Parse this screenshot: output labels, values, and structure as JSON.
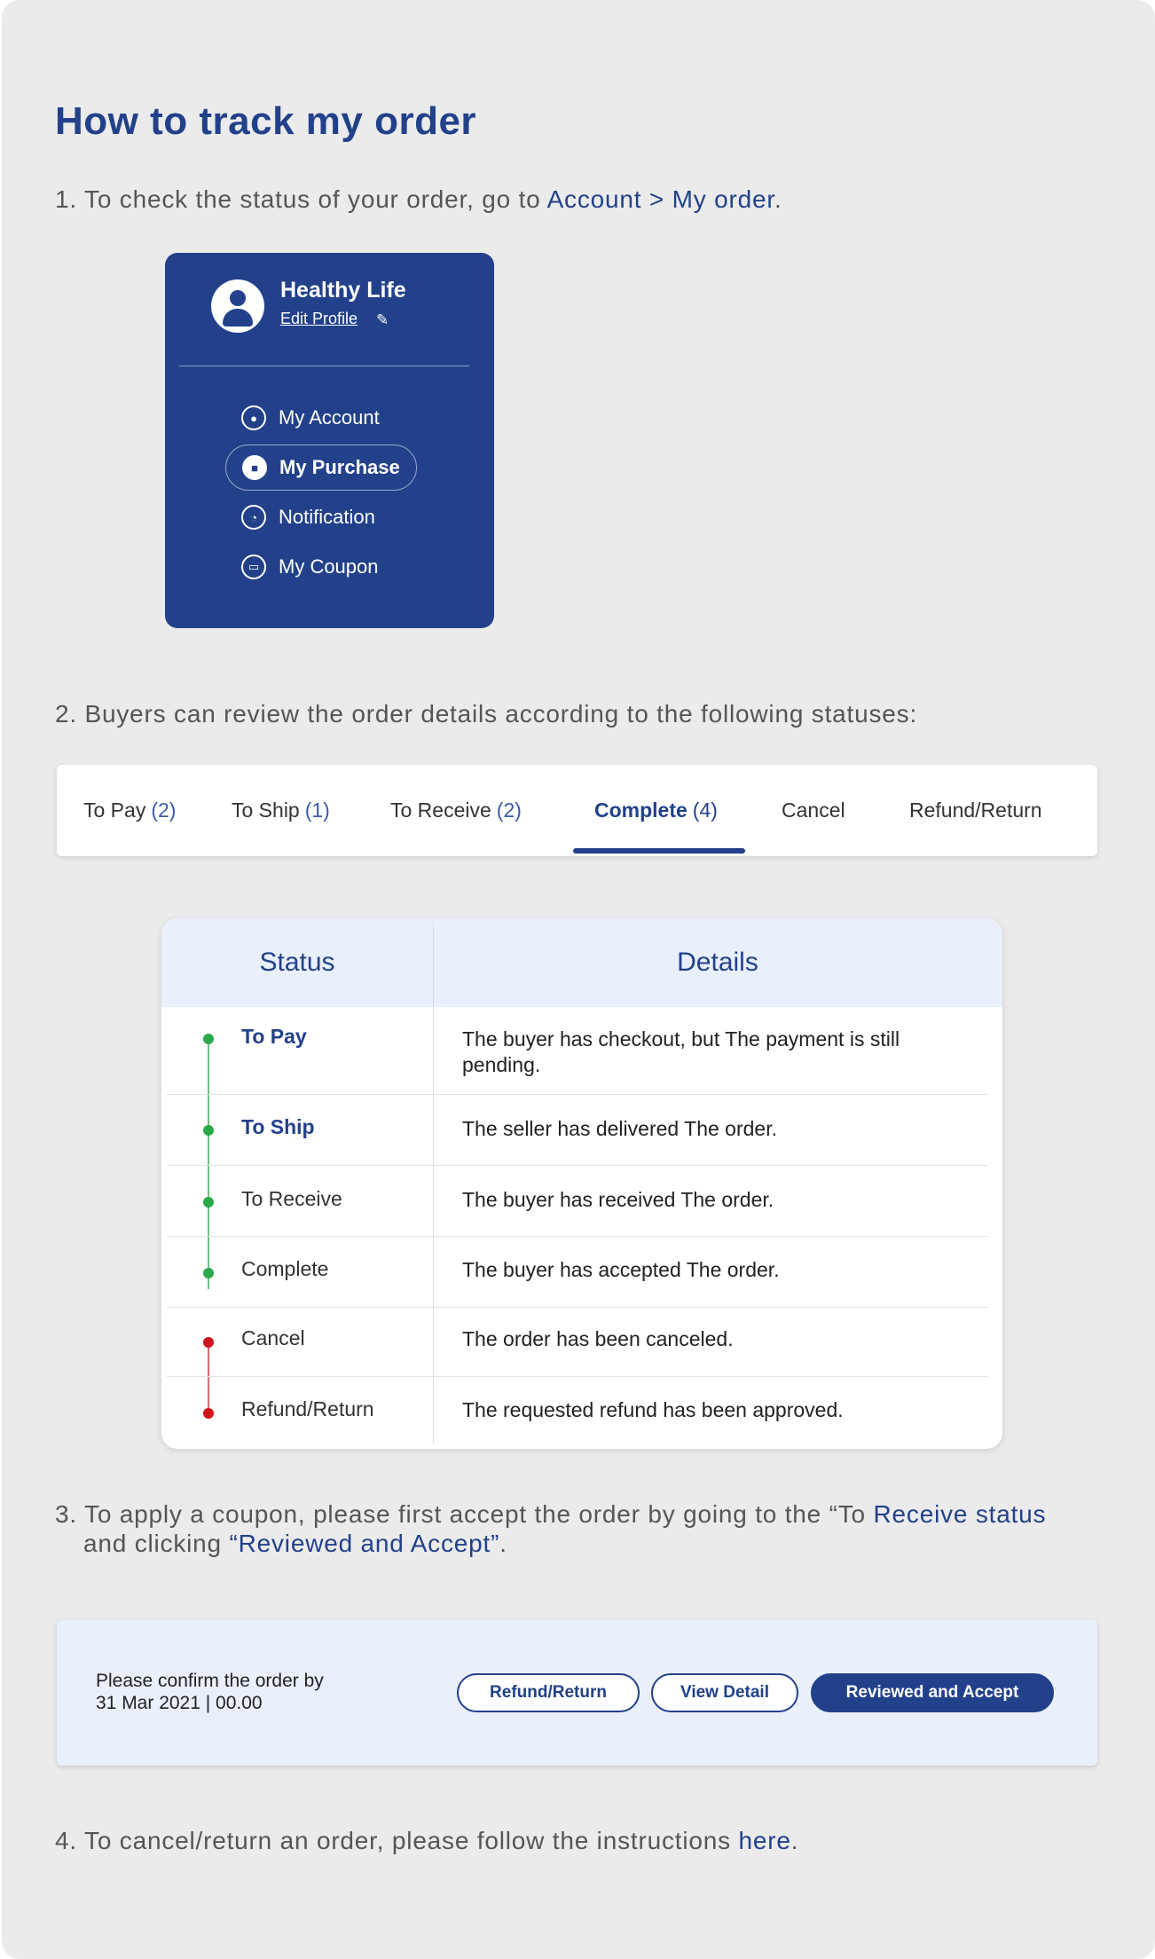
{
  "title": "How to track my order",
  "steps": {
    "s1_prefix": "1. To check the status of your order, go to ",
    "s1_link": "Account > My order",
    "s1_suffix": ".",
    "s2": "2. Buyers can review the order details according to the following statuses:",
    "s3_line1_prefix": "3. To apply a coupon, please first accept the order by going to the “To ",
    "s3_line1_link": "Receive status",
    "s3_line2_prefix": "and clicking ",
    "s3_line2_link": "“Reviewed and Accept”",
    "s3_line2_suffix": ".",
    "s4_prefix": "4. To cancel/return an order, please follow the instructions ",
    "s4_link": "here",
    "s4_suffix": "."
  },
  "profile": {
    "name": "Healthy Life",
    "edit": "Edit Profile",
    "menu": [
      {
        "label": "My Account",
        "icon": "user-icon"
      },
      {
        "label": "My Purchase",
        "icon": "bag-icon"
      },
      {
        "label": "Notification",
        "icon": "bell-icon"
      },
      {
        "label": "My Coupon",
        "icon": "coupon-icon"
      }
    ]
  },
  "tabs": [
    {
      "label": "To Pay",
      "count": "(2)"
    },
    {
      "label": "To Ship",
      "count": "(1)"
    },
    {
      "label": "To Receive",
      "count": "(2)"
    },
    {
      "label": "Complete",
      "count": "(4)"
    },
    {
      "label": "Cancel",
      "count": ""
    },
    {
      "label": "Refund/Return",
      "count": ""
    }
  ],
  "table": {
    "headers": [
      "Status",
      "Details"
    ],
    "rows": [
      {
        "status": "To Pay",
        "detail": "The buyer has checkout, but The payment is still pending."
      },
      {
        "status": "To Ship",
        "detail": "The seller has delivered The order."
      },
      {
        "status": "To Receive",
        "detail": "The buyer has received The order."
      },
      {
        "status": "Complete",
        "detail": "The buyer has accepted The order."
      },
      {
        "status": "Cancel",
        "detail": "The order has been canceled."
      },
      {
        "status": "Refund/Return",
        "detail": "The requested refund has been approved."
      }
    ]
  },
  "confirm": {
    "line1": "Please confirm the order by",
    "line2": "31 Mar 2021 | 00.00",
    "btn_refund": "Refund/Return",
    "btn_view": "View Detail",
    "btn_accept": "Reviewed and Accept"
  },
  "colors": {
    "brand": "#22418a",
    "green": "#2aa84a",
    "red": "#d0131c"
  }
}
